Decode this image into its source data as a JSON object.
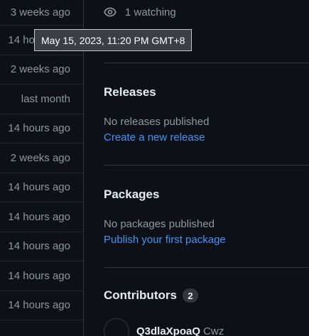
{
  "commit_times": [
    "3 weeks ago",
    "14 hours ago",
    "2 weeks ago",
    "last month",
    "14 hours ago",
    "2 weeks ago",
    "14 hours ago",
    "14 hours ago",
    "14 hours ago",
    "14 hours ago",
    "14 hours ago"
  ],
  "tooltip": "May 15, 2023, 11:20 PM GMT+8",
  "watching": "1 watching",
  "releases": {
    "title": "Releases",
    "empty": "No releases published",
    "action": "Create a new release"
  },
  "packages": {
    "title": "Packages",
    "empty": "No packages published",
    "action": "Publish your first package"
  },
  "contributors": {
    "title": "Contributors",
    "count": "2",
    "first_login": "Q3dlaXpoaQ",
    "first_name": "Cwz"
  },
  "icons": {
    "watch": "eye-icon"
  },
  "colors": {
    "background": "#0d1117",
    "link": "#4493f8",
    "muted": "#9198a1",
    "border": "#30363d"
  }
}
